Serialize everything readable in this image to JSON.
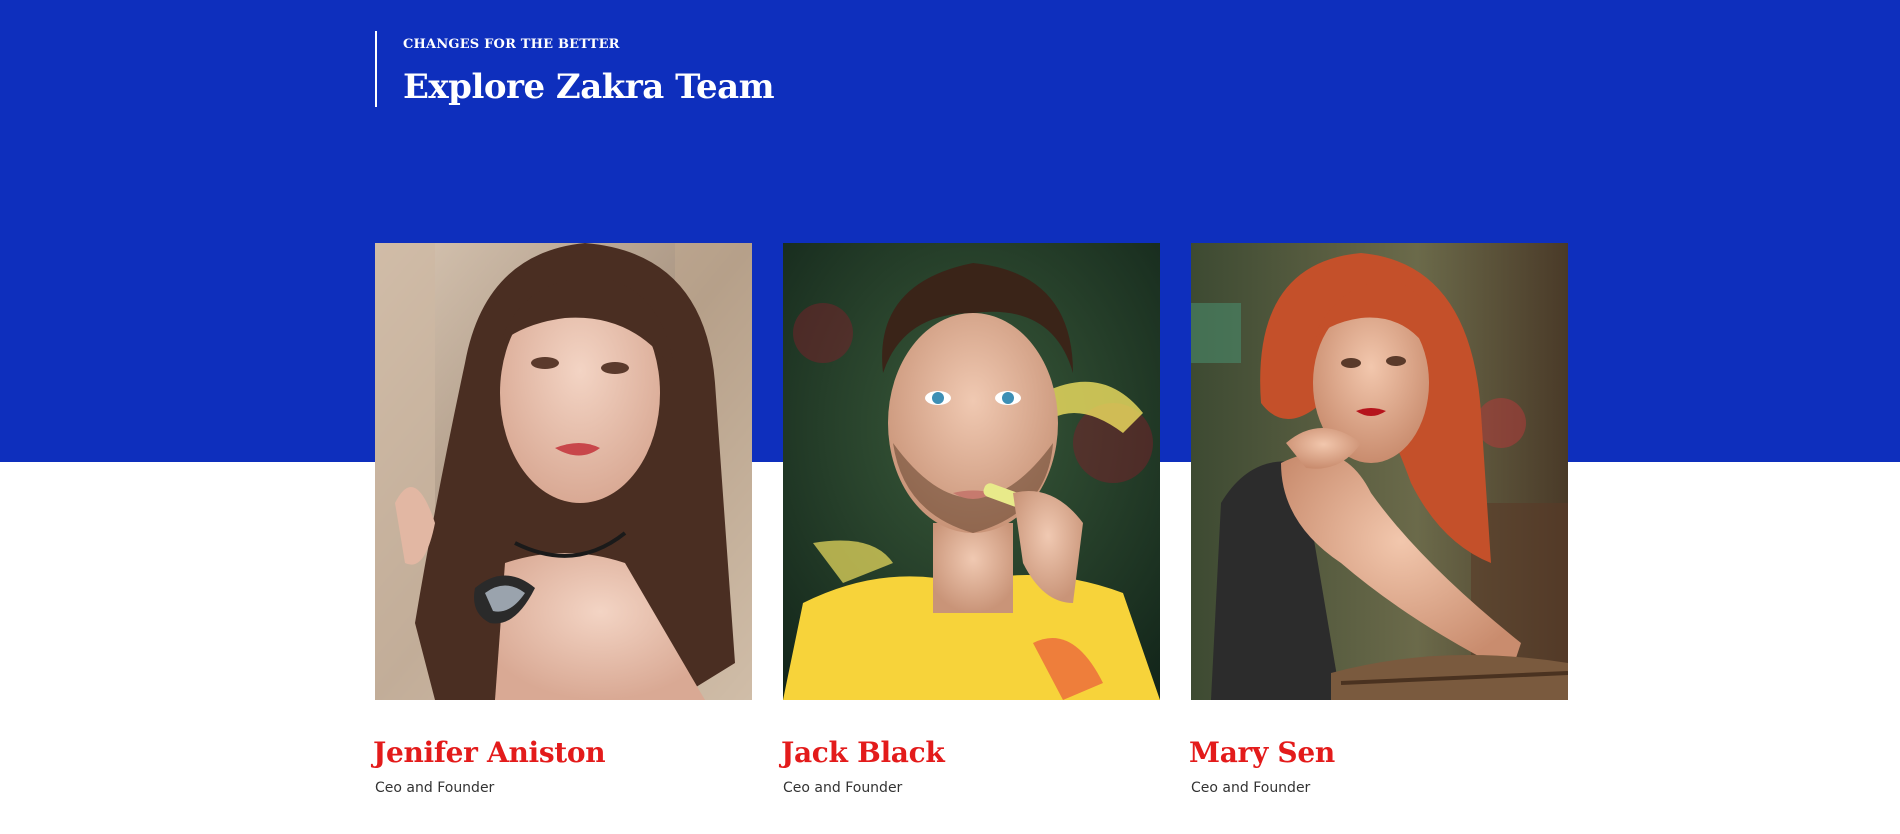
{
  "section": {
    "eyebrow": "CHANGES FOR THE BETTER",
    "title": "Explore Zakra Team"
  },
  "colors": {
    "brand_blue": "#0e2fbd",
    "name_red": "#e31b1b",
    "background": "#ffffff"
  },
  "team": [
    {
      "name": "Jenifer Aniston",
      "role": "Ceo and Founder",
      "photo": "woman-brown-hair-portrait-photo"
    },
    {
      "name": "Jack Black",
      "role": "Ceo and Founder",
      "photo": "man-yellow-shirt-portrait-photo"
    },
    {
      "name": "Mary Sen",
      "role": "Ceo and Founder",
      "photo": "woman-red-hair-portrait-photo"
    }
  ]
}
